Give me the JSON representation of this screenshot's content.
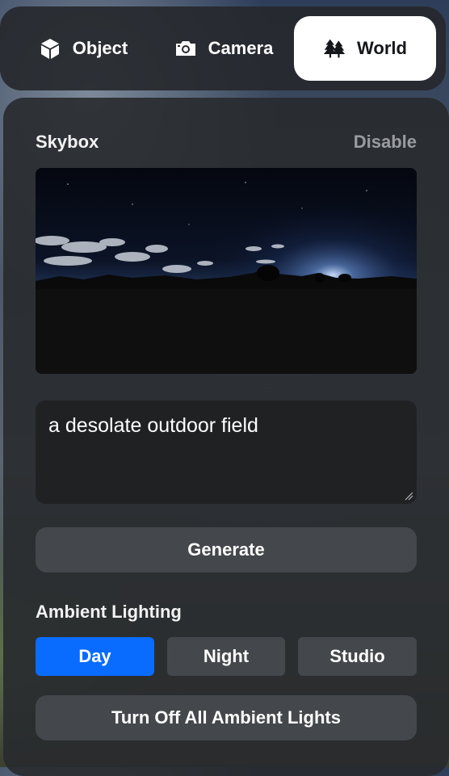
{
  "tabs": {
    "object": {
      "label": "Object",
      "icon": "cube-icon"
    },
    "camera": {
      "label": "Camera",
      "icon": "camera-icon"
    },
    "world": {
      "label": "World",
      "icon": "trees-icon",
      "selected": true
    }
  },
  "skybox": {
    "title": "Skybox",
    "disable_label": "Disable",
    "prompt_value": "a desolate outdoor field",
    "generate_label": "Generate"
  },
  "ambient": {
    "title": "Ambient Lighting",
    "options": [
      "Day",
      "Night",
      "Studio"
    ],
    "selected": "Day",
    "turn_off_label": "Turn Off All Ambient Lights"
  },
  "colors": {
    "accent": "#0a6cff",
    "panel": "#28292c",
    "button": "#44474b",
    "muted_text": "#9a9ca0"
  }
}
